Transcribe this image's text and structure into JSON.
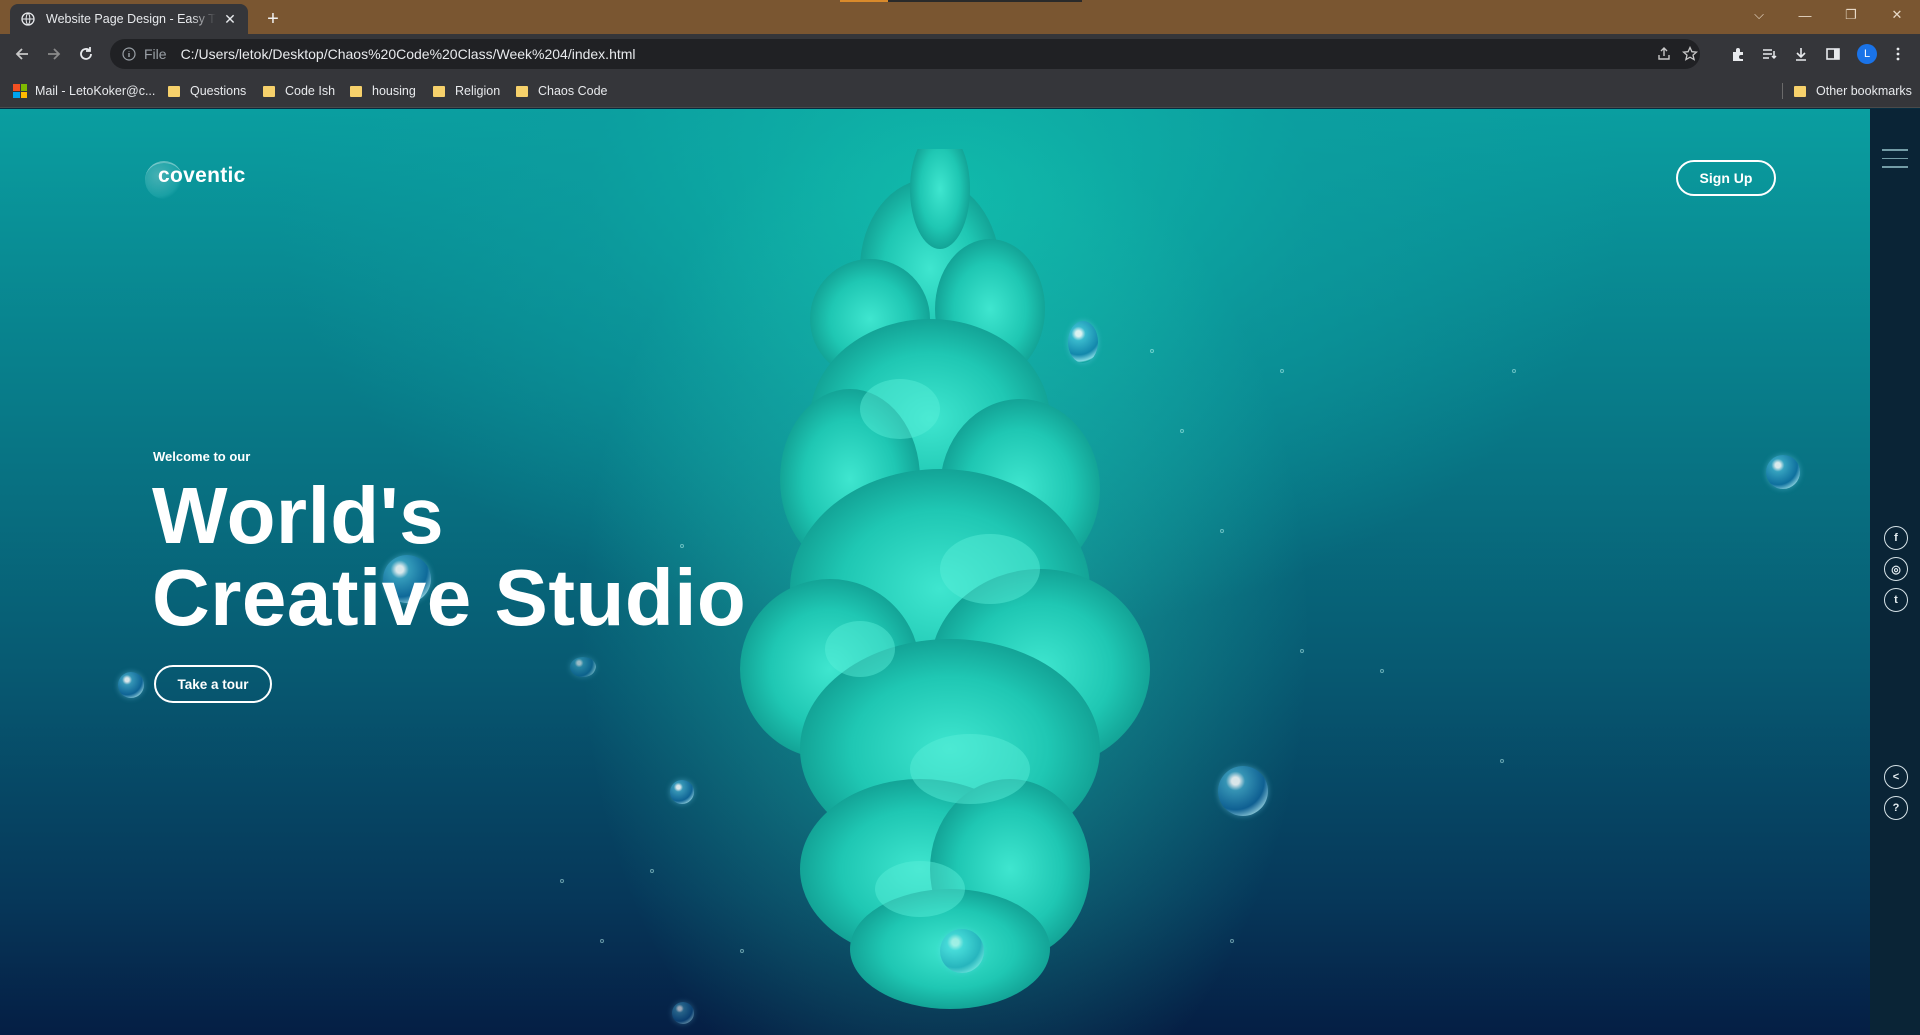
{
  "browser": {
    "tab_title": "Website Page Design - Easy Tutorials",
    "new_tab_symbol": "+",
    "omnibox_scheme": "File",
    "omnibox_url": "C:/Users/letok/Desktop/Chaos%20Code%20Class/Week%204/index.html",
    "profile_initial": "L",
    "bookmarks": [
      {
        "label": "Mail - LetoKoker@c...",
        "icon": "microsoft-icon"
      },
      {
        "label": "Questions",
        "icon": "folder-icon"
      },
      {
        "label": "Code Ish",
        "icon": "folder-icon"
      },
      {
        "label": "housing",
        "icon": "folder-icon"
      },
      {
        "label": "Religion",
        "icon": "folder-icon"
      },
      {
        "label": "Chaos Code",
        "icon": "folder-icon"
      }
    ],
    "other_bookmarks": "Other bookmarks"
  },
  "site": {
    "logo": "coventic",
    "signup_label": "Sign Up",
    "welcome": "Welcome to our",
    "headline_line1": "World's",
    "headline_line2": "Creative Studio",
    "tour_label": "Take a tour",
    "social": {
      "facebook": "f",
      "instagram": "◎",
      "twitter": "t"
    },
    "share_symbol": "<",
    "help_symbol": "?"
  },
  "colors": {
    "accent_teal": "#19d1c0",
    "deep_blue": "#051e44",
    "chrome_title": "#7a5631"
  }
}
